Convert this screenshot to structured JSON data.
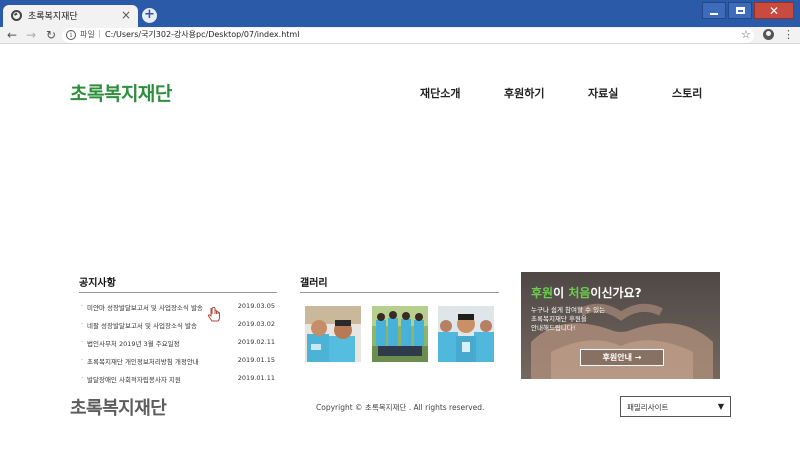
{
  "browser": {
    "tab_title": "초록복지재단",
    "tab_close": "×",
    "new_tab": "+",
    "scheme_label": "파일",
    "address_sep": "|",
    "address": "C:/Users/국기302-강사용pc/Desktop/07/index.html"
  },
  "header": {
    "logo": "초록복지재단",
    "nav": [
      "재단소개",
      "후원하기",
      "자료실",
      "스토리"
    ]
  },
  "notice": {
    "title": "공지사항",
    "items": [
      {
        "title": "미얀마 성장발달보고서 및 사업장소식 발송",
        "date": "2019.03.05"
      },
      {
        "title": "네팔 성장발달보고서 및 사업장소식 발송",
        "date": "2019.03.02"
      },
      {
        "title": "법인사무처 2019년 3월 주요일정",
        "date": "2019.02.11"
      },
      {
        "title": "초록복지재단 개인정보처리방침 개정안내",
        "date": "2019.01.15"
      },
      {
        "title": "발달장애인 사회적자립봉사자 지원",
        "date": "2019.01.11"
      }
    ]
  },
  "gallery": {
    "title": "갤러리"
  },
  "banner": {
    "headline_a": "후원",
    "headline_b": "이 ",
    "headline_c": "처음",
    "headline_d": "이신가요?",
    "sub_1": "누구나 쉽게 참여할 수 있는",
    "sub_2": "초록복지재단 후원을",
    "sub_3": "안내해드립니다!",
    "button": "후원안내 →"
  },
  "footer": {
    "logo": "초록복지재단",
    "copyright": "Copyright © 초록복지재단 . All rights reserved.",
    "family_site": "패밀리사이트",
    "caret": "▼"
  },
  "colors": {
    "brand_green": "#2f8e3e",
    "title_bar": "#2b5aa8"
  }
}
